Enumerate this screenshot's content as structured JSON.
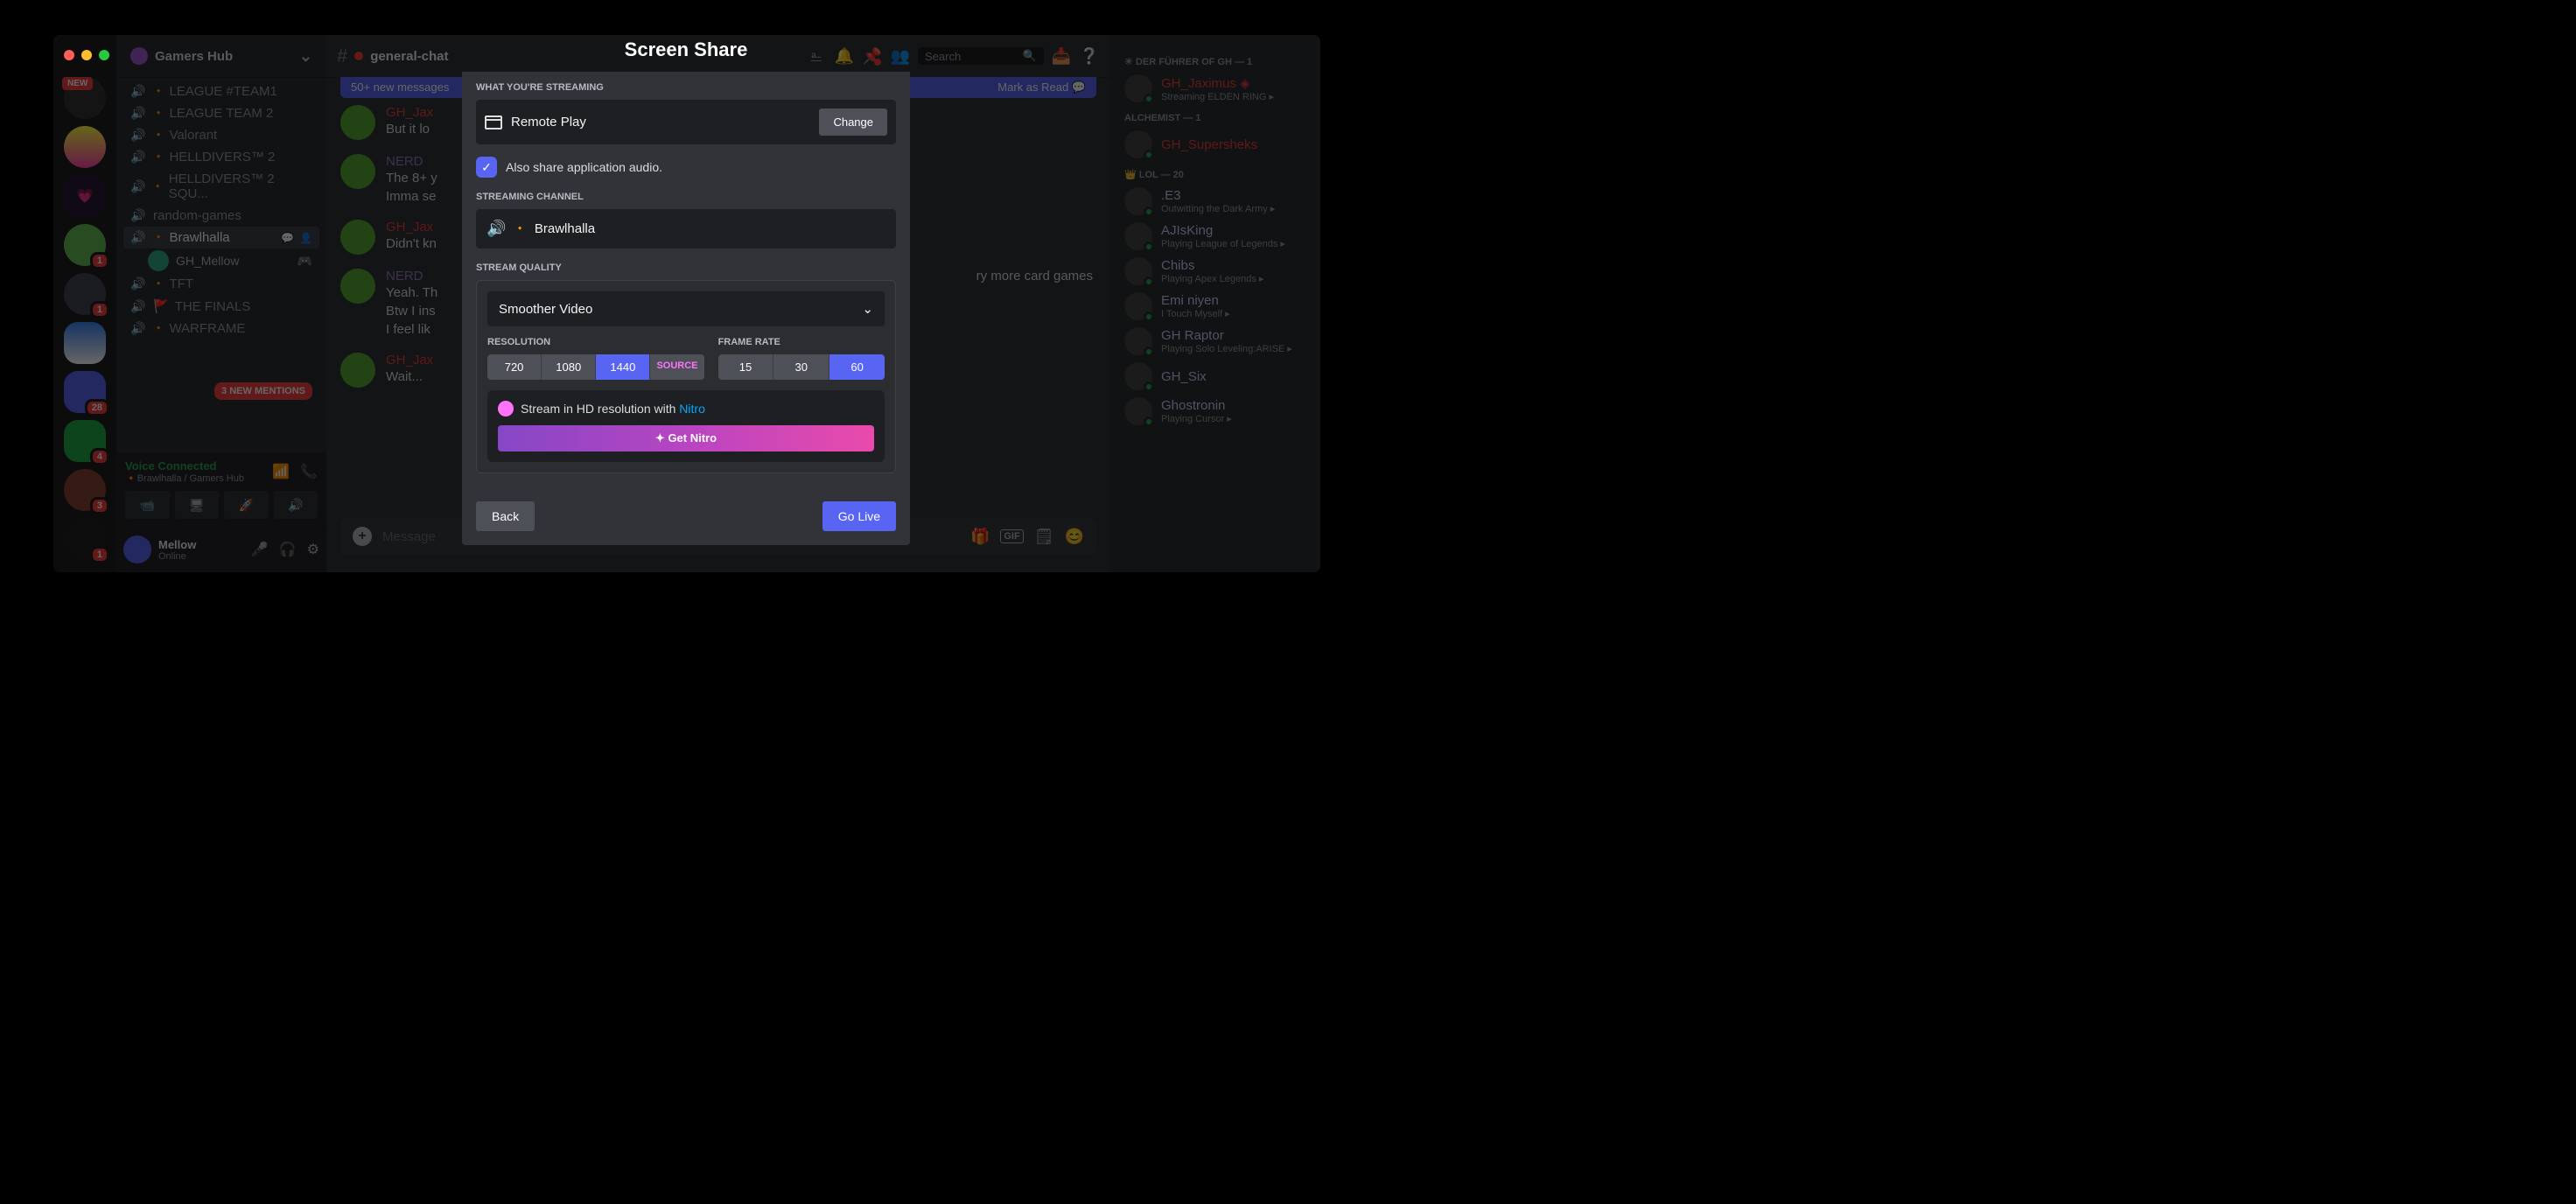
{
  "server": {
    "name": "Gamers Hub",
    "new_badge": "NEW"
  },
  "channels": [
    {
      "name": "LEAGUE #TEAM1",
      "diamond": true
    },
    {
      "name": "LEAGUE TEAM 2",
      "diamond": true
    },
    {
      "name": "Valorant",
      "diamond": true
    },
    {
      "name": "HELLDIVERS™ 2",
      "diamond": true
    },
    {
      "name": "HELLDIVERS™ 2 SQU...",
      "diamond": true
    },
    {
      "name": "random-games",
      "diamond": false
    },
    {
      "name": "Brawlhalla",
      "diamond": true,
      "active": true,
      "user": "GH_Mellow"
    },
    {
      "name": "TFT",
      "diamond": true
    },
    {
      "name": "THE FINALS",
      "flag": true
    },
    {
      "name": "WARFRAME",
      "diamond": true
    }
  ],
  "mentions_pill": "3 NEW MENTIONS",
  "vc": {
    "status": "Voice Connected",
    "where": "Brawlhalla / Gamers Hub"
  },
  "current_channel": "general-chat",
  "user": {
    "name": "Mellow",
    "status": "Online"
  },
  "search_placeholder": "Search",
  "new_bar": {
    "count": "50+ new messages",
    "mark": "Mark as Read"
  },
  "messages": [
    {
      "author": "GH_Jax",
      "cls": "auth-red",
      "text": "But it lo"
    },
    {
      "author": "NERD",
      "cls": "auth-pur",
      "text": "The 8+ y\nImma se"
    },
    {
      "author": "GH_Jax",
      "cls": "auth-red",
      "text": "Didn't kn"
    },
    {
      "author": "NERD",
      "cls": "auth-pur",
      "text": "Yeah. Th\nBtw I ins\nI feel lik",
      "tail": "ry more card games"
    },
    {
      "author": "GH_Jax",
      "cls": "auth-red",
      "text": "Wait..."
    }
  ],
  "input_placeholder": "Message",
  "roles": [
    {
      "label": "☀ DER FÜHRER OF GH — 1",
      "members": [
        {
          "name": "GH_Jaximus",
          "color": "#e8413a",
          "act": "Streaming ELDEN RING",
          "stream": true
        }
      ]
    },
    {
      "label": "ALCHEMIST — 1",
      "members": [
        {
          "name": "GH_Supersheks",
          "color": "#e8413a",
          "act": ""
        }
      ]
    },
    {
      "label": "👑 LOL — 20",
      "members": [
        {
          "name": ".E3",
          "color": "#c9cdfb",
          "act": "Outwitting the Dark Army"
        },
        {
          "name": "AJIsKing",
          "color": "#c9cdfb",
          "act": "Playing League of Legends"
        },
        {
          "name": "Chibs",
          "color": "#c9cdfb",
          "act": "Playing Apex Legends"
        },
        {
          "name": "Emi niyen",
          "color": "#c9cdfb",
          "act": "I Touch Myself"
        },
        {
          "name": "GH Raptor",
          "color": "#c9cdfb",
          "act": "Playing Solo Leveling:ARISE"
        },
        {
          "name": "GH_Six",
          "color": "#c9cdfb",
          "act": ""
        },
        {
          "name": "Ghostronin",
          "color": "#c9cdfb",
          "act": "Playing Cursor"
        }
      ]
    }
  ],
  "modal": {
    "title": "Screen Share",
    "sec_streaming": "WHAT YOU'RE STREAMING",
    "source_name": "Remote Play",
    "change": "Change",
    "share_audio": "Also share application audio.",
    "sec_channel": "STREAMING CHANNEL",
    "channel_name": "Brawlhalla",
    "sec_quality": "STREAM QUALITY",
    "preset": "Smoother Video",
    "res_label": "RESOLUTION",
    "res": [
      {
        "v": "720"
      },
      {
        "v": "1080"
      },
      {
        "v": "1440",
        "on": true
      },
      {
        "v": "SOURCE",
        "nitro": true
      }
    ],
    "fps_label": "FRAME RATE",
    "fps": [
      {
        "v": "15"
      },
      {
        "v": "30"
      },
      {
        "v": "60",
        "on": true
      }
    ],
    "nitro_text": "Stream in HD resolution with ",
    "nitro_link": "Nitro",
    "get_nitro": "Get Nitro",
    "back": "Back",
    "go": "Go Live"
  },
  "server_badges": [
    "",
    "",
    "",
    "1",
    "1",
    "",
    "28",
    "4",
    "",
    "3",
    "1"
  ]
}
